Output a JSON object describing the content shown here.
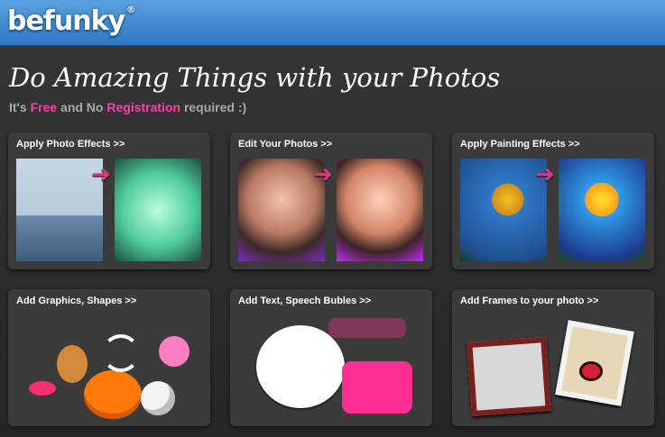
{
  "header": {
    "logo": {
      "text": "befunky",
      "trademark": "®",
      "colors": [
        "#ffb000",
        "#3fb2ff",
        "#ff3fae"
      ]
    }
  },
  "hero": {
    "title": "Do Amazing Things with your Photos",
    "subtitle": {
      "prefix": "It's ",
      "free": "Free",
      "middle": " and No ",
      "registration": "Registration",
      "suffix": " required :)"
    }
  },
  "cards": [
    {
      "title": "Apply Photo Effects >>",
      "icons": [
        "seagull-photo",
        "seagull-effect-photo",
        "arrow-right-icon"
      ]
    },
    {
      "title": "Edit Your Photos >>",
      "icons": [
        "face-photo",
        "face-edited-photo",
        "arrow-right-icon"
      ]
    },
    {
      "title": "Apply Painting Effects >>",
      "icons": [
        "sunflower-photo",
        "sunflower-painted-photo",
        "arrow-right-icon"
      ]
    },
    {
      "title": "Add Graphics, Shapes >>",
      "icons": [
        "lips-icon",
        "gingerbread-icon",
        "pumpkin-icon",
        "pig-icon",
        "soccer-ball-icon",
        "arrows-icon"
      ]
    },
    {
      "title": "Add Text, Speech Bubles >>",
      "icons": [
        "speech-bubble-icon",
        "love-you-text",
        "congrats-text",
        "happy-birthday-bubble"
      ]
    },
    {
      "title": "Add Frames to your photo >>",
      "icons": [
        "frame-icon",
        "polaroid-icon",
        "ladybug-icon"
      ]
    }
  ],
  "colors": {
    "accent_pink": "#ff3fae",
    "header_blue": "#3b86d1"
  }
}
